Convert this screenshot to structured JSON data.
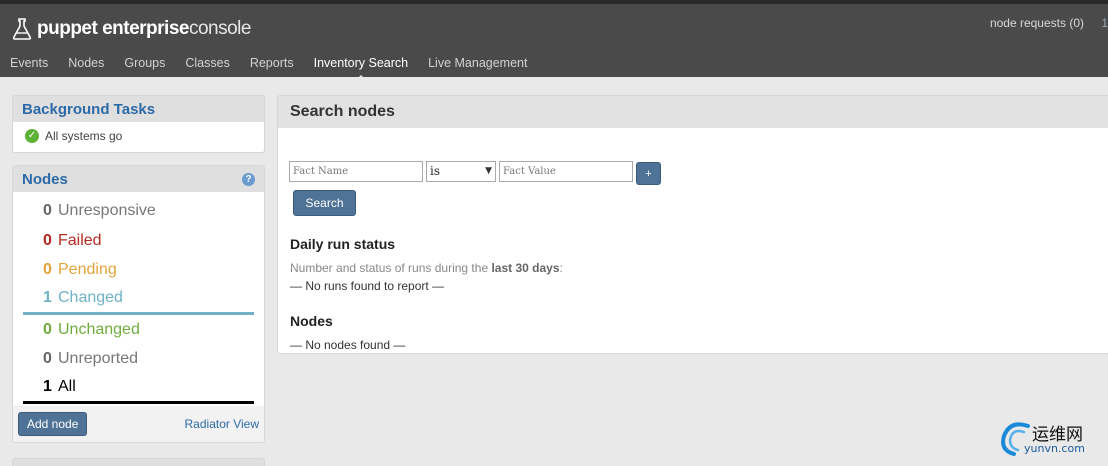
{
  "header": {
    "logo_bold": "puppet enterprise",
    "logo_light": "console",
    "node_requests": "node requests (0)",
    "corner_partial": "1"
  },
  "nav": {
    "items": [
      {
        "label": "Events",
        "active": false
      },
      {
        "label": "Nodes",
        "active": false
      },
      {
        "label": "Groups",
        "active": false
      },
      {
        "label": "Classes",
        "active": false
      },
      {
        "label": "Reports",
        "active": false
      },
      {
        "label": "Inventory Search",
        "active": true
      },
      {
        "label": "Live Management",
        "active": false
      }
    ]
  },
  "sidebar": {
    "background_tasks": {
      "title": "Background Tasks",
      "status": "All systems go"
    },
    "nodes": {
      "title": "Nodes",
      "statuses": [
        {
          "count": "0",
          "label": "Unresponsive"
        },
        {
          "count": "0",
          "label": "Failed"
        },
        {
          "count": "0",
          "label": "Pending"
        },
        {
          "count": "1",
          "label": "Changed"
        },
        {
          "count": "0",
          "label": "Unchanged"
        },
        {
          "count": "0",
          "label": "Unreported"
        },
        {
          "count": "1",
          "label": "All"
        }
      ],
      "add_node": "Add node",
      "radiator_view": "Radiator View"
    }
  },
  "main": {
    "title": "Search nodes",
    "fact_name_placeholder": "Fact Name",
    "operator": "is",
    "fact_value_placeholder": "Fact Value",
    "plus_label": "+",
    "search_label": "Search",
    "daily_run_status": {
      "title": "Daily run status",
      "desc_prefix": "Number and status of runs during the ",
      "desc_bold": "last 30 days",
      "desc_suffix": ":",
      "empty": "— No runs found to report —"
    },
    "nodes": {
      "title": "Nodes",
      "empty": "— No nodes found —"
    }
  },
  "watermark": {
    "text": "运维网",
    "url": "yunvn.com"
  },
  "colors": {
    "header_bg": "#4a4a4a",
    "accent_blue": "#2c6aa8",
    "button_blue": "#4f7396",
    "failed": "#b52a1f",
    "pending": "#e4a33a",
    "changed": "#6fb2c6",
    "unchanged": "#70ad3e"
  }
}
